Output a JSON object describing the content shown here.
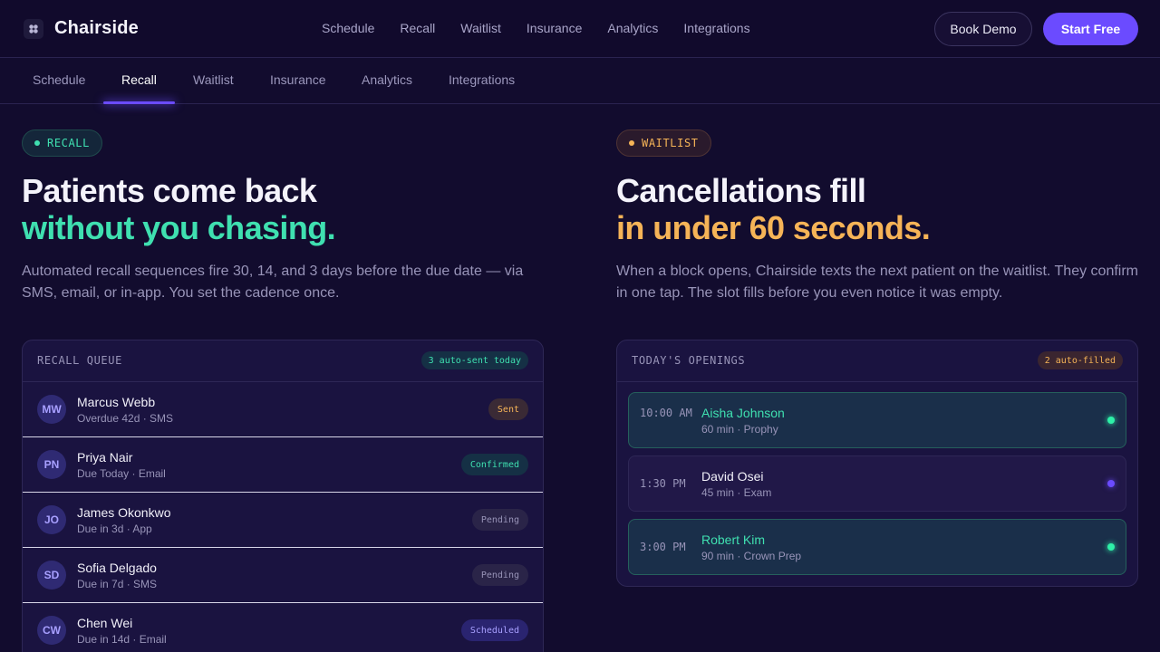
{
  "brand": {
    "name": "Chairside",
    "icon": "tooth-icon"
  },
  "nav": {
    "links": [
      "Schedule",
      "Recall",
      "Waitlist",
      "Insurance",
      "Analytics",
      "Integrations"
    ],
    "book_demo": "Book Demo",
    "start_free": "Start Free"
  },
  "subnav": {
    "tabs": [
      "Schedule",
      "Recall",
      "Waitlist",
      "Insurance",
      "Analytics",
      "Integrations"
    ],
    "active": "Recall"
  },
  "recall": {
    "pill": "RECALL",
    "headline_1": "Patients come back",
    "headline_2": "without you chasing.",
    "lead": "Automated recall sequences fire 30, 14, and 3 days before the due date — via SMS, email, or in-app. You set the cadence once.",
    "card_title": "RECALL QUEUE",
    "badge": "3 auto-sent today",
    "rows": [
      {
        "initials": "MW",
        "name": "Marcus Webb",
        "sub": "Overdue 42d · SMS",
        "status": "Sent"
      },
      {
        "initials": "PN",
        "name": "Priya Nair",
        "sub": "Due Today · Email",
        "status": "Confirmed"
      },
      {
        "initials": "JO",
        "name": "James Okonkwo",
        "sub": "Due in 3d · App",
        "status": "Pending"
      },
      {
        "initials": "SD",
        "name": "Sofia Delgado",
        "sub": "Due in 7d · SMS",
        "status": "Pending"
      },
      {
        "initials": "CW",
        "name": "Chen Wei",
        "sub": "Due in 14d · Email",
        "status": "Scheduled"
      }
    ]
  },
  "waitlist": {
    "pill": "WAITLIST",
    "headline_1": "Cancellations fill",
    "headline_2": "in under 60 seconds.",
    "lead": "When a block opens, Chairside texts the next patient on the waitlist. They confirm in one tap. The slot fills before you even notice it was empty.",
    "card_title": "TODAY'S OPENINGS",
    "badge": "2 auto-filled",
    "slots": [
      {
        "time": "10:00 AM",
        "name": "Aisha Johnson",
        "sub": "60 min · Prophy",
        "state": "filled"
      },
      {
        "time": "1:30 PM",
        "name": "David Osei",
        "sub": "45 min · Exam",
        "state": "open"
      },
      {
        "time": "3:00 PM",
        "name": "Robert Kim",
        "sub": "90 min · Crown Prep",
        "state": "filled"
      }
    ]
  },
  "colors": {
    "accent": "#6b4bff",
    "green": "#3fe0b0",
    "amber": "#f6b457",
    "background": "#120c2e"
  }
}
